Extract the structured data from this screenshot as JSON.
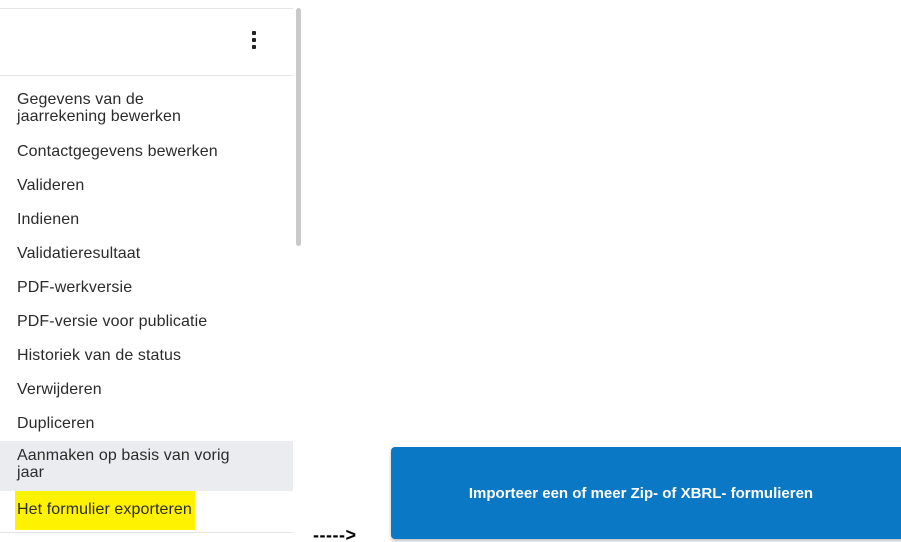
{
  "menu": {
    "more_icon": "vertical-ellipsis",
    "items": [
      {
        "label": "Gegevens van de jaarrekening bewerken"
      },
      {
        "label": "Contactgegevens bewerken"
      },
      {
        "label": "Valideren"
      },
      {
        "label": "Indienen"
      },
      {
        "label": "Validatieresultaat"
      },
      {
        "label": "PDF-werkversie"
      },
      {
        "label": "PDF-versie voor publicatie"
      },
      {
        "label": "Historiek van de status"
      },
      {
        "label": "Verwijderen"
      },
      {
        "label": "Dupliceren"
      },
      {
        "label": "Aanmaken op basis van vorig jaar"
      },
      {
        "label": "Het formulier exporteren"
      }
    ],
    "highlight_color": "#fff200",
    "hover_color": "#ebecef"
  },
  "annotation": {
    "arrow_text": "----->"
  },
  "import_button": {
    "label": "Importeer een of meer Zip- of XBRL- formulieren",
    "color": "#0a78c4"
  }
}
